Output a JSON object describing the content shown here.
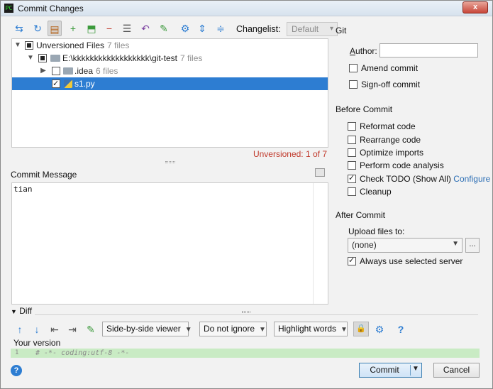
{
  "window": {
    "title": "Commit Changes",
    "close_label": "x"
  },
  "toolbar": {
    "changelist_label": "Changelist:",
    "changelist_value": "Default"
  },
  "tree": {
    "rows": [
      {
        "label": "Unversioned Files",
        "count": "7 files"
      },
      {
        "label": "E:\\kkkkkkkkkkkkkkkkkk\\git-test",
        "count": "7 files"
      },
      {
        "label": ".idea",
        "count": "6 files"
      },
      {
        "label": "s1.py",
        "count": ""
      }
    ],
    "status": "Unversioned: 1 of 7"
  },
  "commit_message": {
    "label": "Commit Message",
    "value": "tian"
  },
  "git": {
    "section": "Git",
    "author_label": "Author:",
    "author_value": "",
    "amend_commit": "Amend commit",
    "signoff_commit": "Sign-off commit"
  },
  "before_commit": {
    "section": "Before Commit",
    "options": [
      {
        "label": "Reformat code",
        "checked": false
      },
      {
        "label": "Rearrange code",
        "checked": false
      },
      {
        "label": "Optimize imports",
        "checked": false
      },
      {
        "label": "Perform code analysis",
        "checked": false
      },
      {
        "label": "Check TODO (Show All)",
        "checked": true
      },
      {
        "label": "Cleanup",
        "checked": false
      }
    ],
    "configure_link": "Configure"
  },
  "after_commit": {
    "section": "After Commit",
    "upload_label": "Upload files to:",
    "upload_value": "(none)",
    "browse_label": "...",
    "always_use_label": "Always use selected server"
  },
  "diff": {
    "header": "Diff",
    "viewer": "Side-by-side viewer",
    "ignore": "Do not ignore",
    "highlight": "Highlight words",
    "help": "?",
    "your_version": "Your version",
    "line_number": "1",
    "line_code": "# -*- coding:utf-8 -*-"
  },
  "footer": {
    "commit_label": "Commit",
    "cancel_label": "Cancel",
    "help": "?"
  }
}
